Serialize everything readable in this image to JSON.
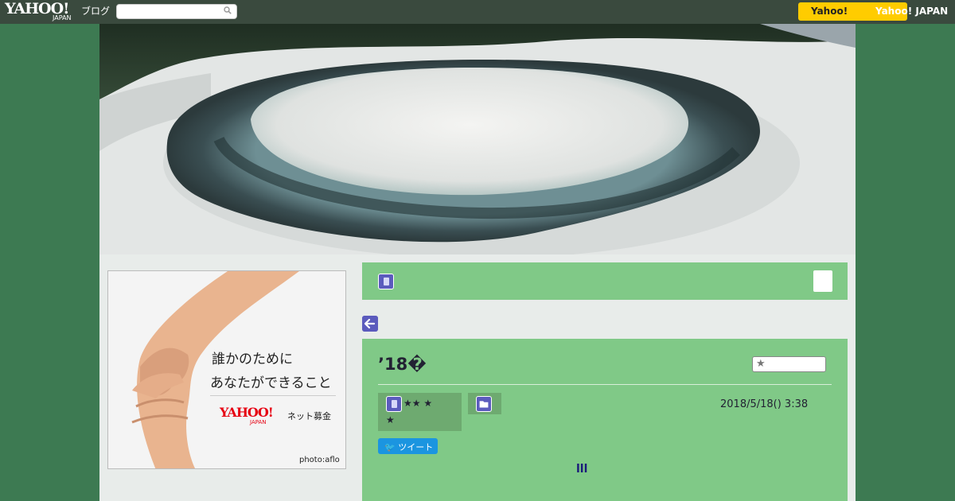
{
  "topbar": {
    "logo_text": "YAHOO!",
    "logo_sub": "JAPAN",
    "blog_label": "ブログ",
    "search_placeholder": "",
    "yahoo_button": "Yahoo!",
    "yahoo_japan_link": "Yahoo! JAPAN"
  },
  "ad": {
    "line1": "誰かのために",
    "line2": "あなたができること",
    "brand": "YAHOO!",
    "brand_sub": "JAPAN",
    "service": "ネット募金",
    "credit": "photo:aflo"
  },
  "article": {
    "title": "’18�",
    "tag_stars": "★★ ★",
    "tag_star2": "★",
    "date": "2018/5/18()  3:38",
    "tweet_label": "ツイート",
    "bars": "lll"
  },
  "colors": {
    "page_bg": "#3d7a52",
    "topbar_bg": "#3a4a3e",
    "panel_green": "#80c987",
    "accent_purple": "#5b5bbd",
    "yahoo_yellow": "#ffcc00",
    "tweet_blue": "#1b95e0"
  }
}
